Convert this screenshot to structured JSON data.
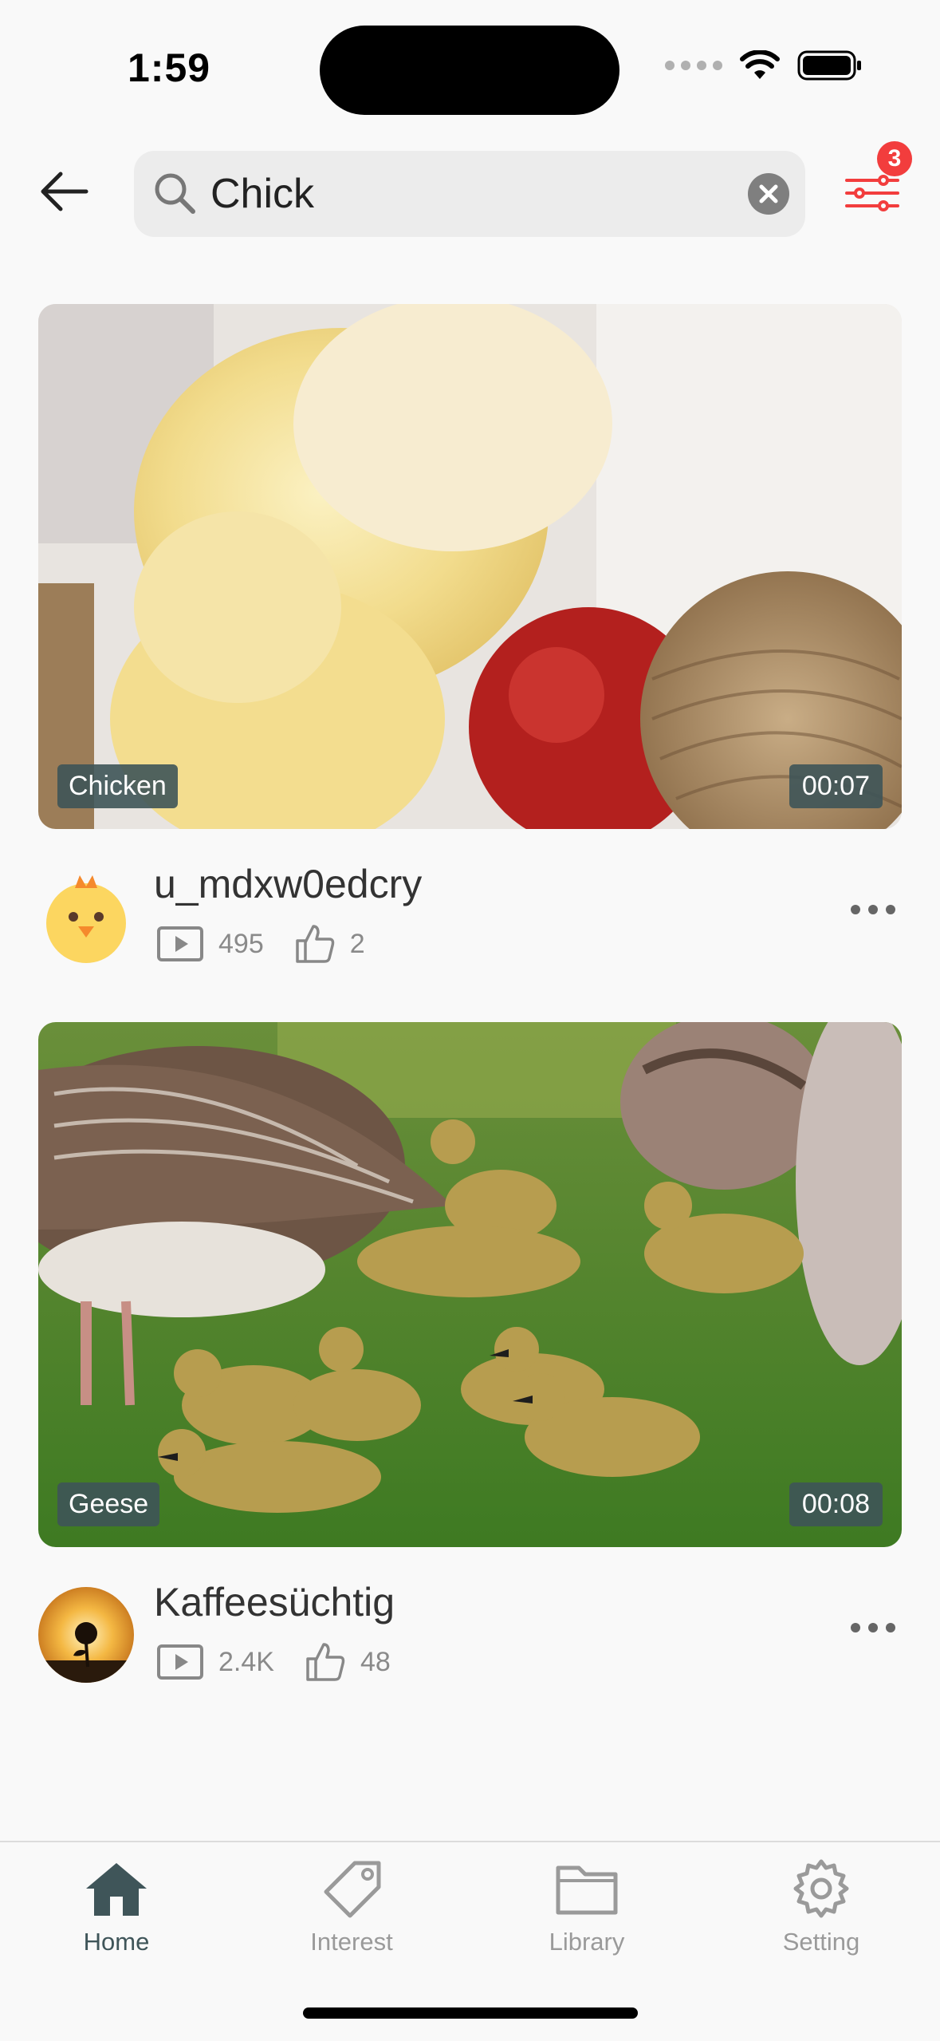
{
  "status_bar": {
    "time": "1:59"
  },
  "header": {
    "search_value": "Chick",
    "filter_badge": "3"
  },
  "colors": {
    "accent": "#f23d3d",
    "nav_active": "#3f5559",
    "nav_inactive": "#9a9a9a",
    "chip_bg": "#3e5458"
  },
  "videos": [
    {
      "tag": "Chicken",
      "duration": "00:07",
      "author": "u_mdxw0edcry",
      "views": "495",
      "likes": "2",
      "avatar_icon": "chick-icon"
    },
    {
      "tag": "Geese",
      "duration": "00:08",
      "author": "Kaffeesüchtig",
      "views": "2.4K",
      "likes": "48",
      "avatar_icon": "sunflower-sunset-avatar"
    }
  ],
  "nav": [
    {
      "label": "Home",
      "icon": "home-icon",
      "active": true
    },
    {
      "label": "Interest",
      "icon": "tag-icon",
      "active": false
    },
    {
      "label": "Library",
      "icon": "folder-icon",
      "active": false
    },
    {
      "label": "Setting",
      "icon": "gear-icon",
      "active": false
    }
  ]
}
